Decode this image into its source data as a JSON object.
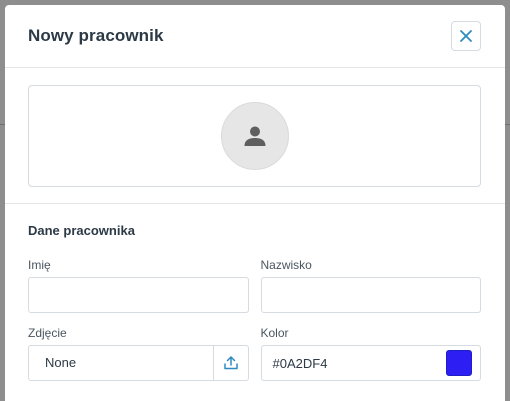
{
  "modal": {
    "title": "Nowy pracownik",
    "close_icon": "close-icon"
  },
  "photo": {
    "avatar_icon": "user-icon"
  },
  "form": {
    "section_title": "Dane pracownika",
    "first_name": {
      "label": "Imię",
      "value": ""
    },
    "last_name": {
      "label": "Nazwisko",
      "value": ""
    },
    "photo_field": {
      "label": "Zdjęcie",
      "value": "None",
      "upload_icon": "upload-icon"
    },
    "color_field": {
      "label": "Kolor",
      "value": "#0A2DF4",
      "swatch_color": "#2d1ff4"
    }
  },
  "colors": {
    "accent": "#2e8bc0",
    "overlay": "#8e8e8e"
  }
}
